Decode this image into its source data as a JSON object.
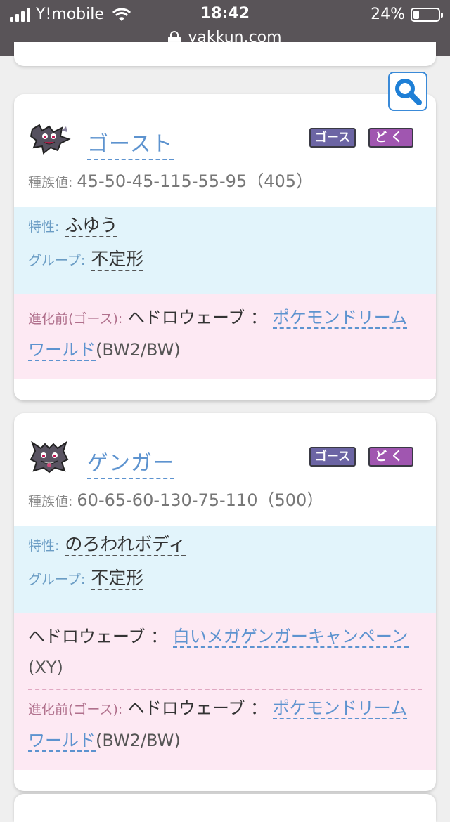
{
  "status": {
    "carrier": "Y!mobile",
    "time": "18:42",
    "battery": "24%",
    "battery_level": 0.24,
    "url": "yakkun.com"
  },
  "search_icon": "magnifier-icon",
  "cards": [
    {
      "name": "ゴースト",
      "types": [
        "ゴースト",
        "どく"
      ],
      "stats_label": "種族値:",
      "stats": "45-50-45-115-55-95（405）",
      "ability_label": "特性:",
      "ability": "ふゆう",
      "group_label": "グループ:",
      "group": "不定形",
      "moves": [
        {
          "label": "進化前(ゴース):",
          "move": "ヘドロウェーブ ：",
          "event": "ポケモンドリーム",
          "event2": "ワールド",
          "game": "(BW2/BW)"
        }
      ]
    },
    {
      "name": "ゲンガー",
      "types": [
        "ゴースト",
        "どく"
      ],
      "stats_label": "種族値:",
      "stats": "60-65-60-130-75-110（500）",
      "ability_label": "特性:",
      "ability": "のろわれボディ",
      "group_label": "グループ:",
      "group": "不定形",
      "moves": [
        {
          "move": "ヘドロウェーブ ：",
          "event": "白いメガゲンガーキャンペーン",
          "game": "(XY)"
        },
        {
          "label": "進化前(ゴース):",
          "move": "ヘドロウェーブ ：",
          "event": "ポケモンドリーム",
          "event2": "ワールド",
          "game": "(BW2/BW)"
        }
      ]
    }
  ],
  "colors": {
    "status_bar": "#595458",
    "link": "#5d93cf",
    "ghost_type": "#6c65a4",
    "poison_type": "#a056b0",
    "info_bg": "#e2f4fb",
    "move_bg": "#fde9f3"
  }
}
